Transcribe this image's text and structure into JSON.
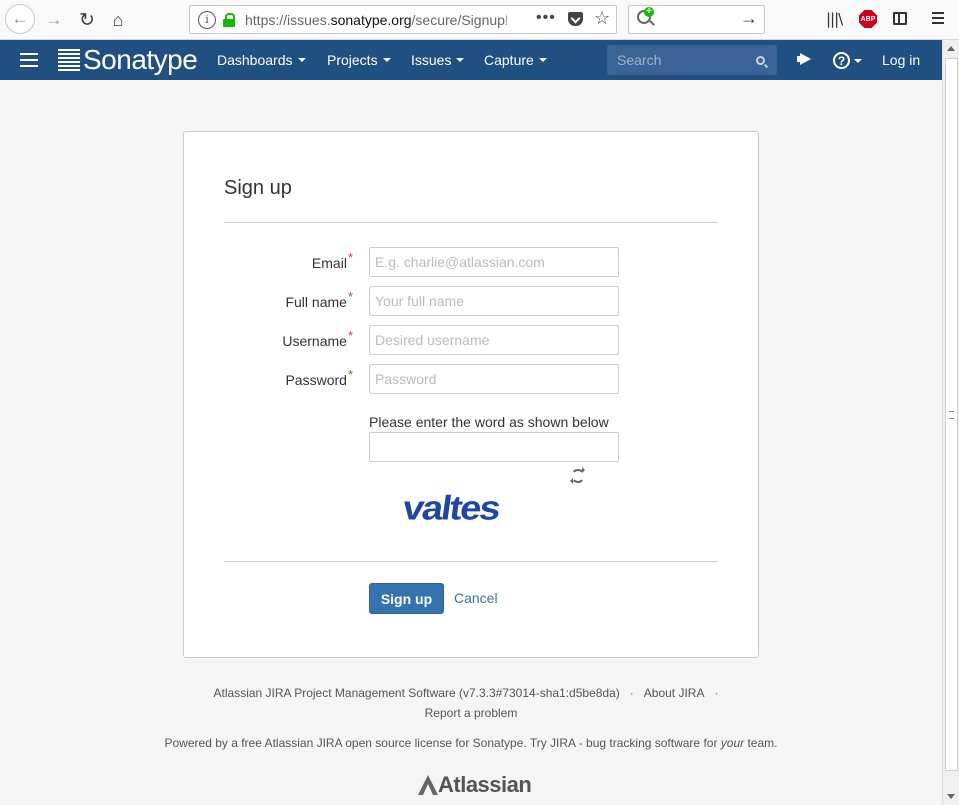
{
  "browser": {
    "url_prefix": "https://issues.",
    "url_domain": "sonatype.org",
    "url_suffix": "/secure/Signup!",
    "page_actions": "•••",
    "star": "☆",
    "go_arrow": "→",
    "library": "|||\\",
    "abp": "ABP"
  },
  "header": {
    "logo_text": "Sonatype",
    "nav": [
      {
        "label": "Dashboards"
      },
      {
        "label": "Projects"
      },
      {
        "label": "Issues"
      },
      {
        "label": "Capture"
      }
    ],
    "search_placeholder": "Search",
    "help_glyph": "?",
    "login": "Log in"
  },
  "form": {
    "title": "Sign up",
    "fields": [
      {
        "label": "Email",
        "placeholder": "E.g. charlie@atlassian.com"
      },
      {
        "label": "Full name",
        "placeholder": "Your full name"
      },
      {
        "label": "Username",
        "placeholder": "Desired username"
      },
      {
        "label": "Password",
        "placeholder": "Password"
      }
    ],
    "required_mark": "*",
    "captcha_label": "Please enter the word as shown below",
    "captcha_word": "valtes",
    "submit": "Sign up",
    "cancel": "Cancel"
  },
  "footer": {
    "version": "Atlassian JIRA Project Management Software (v7.3.3#73014-sha1:d5be8da)",
    "about": "About JIRA",
    "report": "Report a problem",
    "powered_prefix": "Powered by a free Atlassian JIRA open source license for Sonatype. Try JIRA - bug tracking software for ",
    "powered_em": "your",
    "powered_suffix": " team.",
    "dot": "·",
    "atlassian_logo": "Atlassian"
  },
  "colors": {
    "header_bg": "#205081",
    "primary_button": "#3572b0",
    "link": "#3572b0",
    "required": "#d04437"
  }
}
